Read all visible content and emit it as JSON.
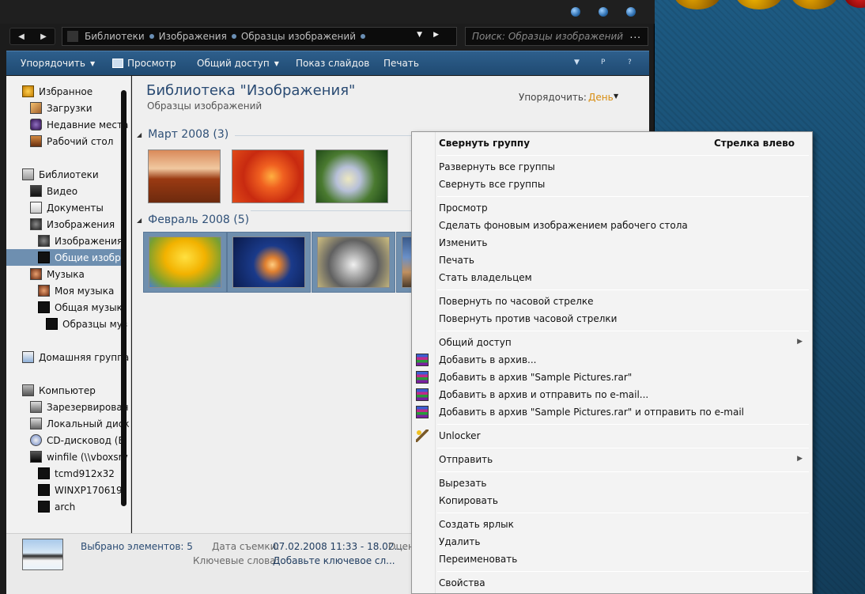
{
  "breadcrumb": [
    "Библиотеки",
    "Изображения",
    "Образцы изображений"
  ],
  "search": {
    "placeholder": "Поиск: Образцы изображений"
  },
  "toolbar": {
    "organize": "Упорядочить",
    "preview": "Просмотр",
    "share": "Общий доступ",
    "slideshow": "Показ слайдов",
    "print": "Печать"
  },
  "nav": [
    {
      "label": "Избранное",
      "icon": "star-icon"
    },
    {
      "label": "Загрузки",
      "icon": "downloads-icon"
    },
    {
      "label": "Недавние места",
      "icon": "recent-places-icon"
    },
    {
      "label": "Рабочий стол",
      "icon": "desktop-icon"
    },
    {
      "label": "Библиотеки",
      "icon": "libraries-icon"
    },
    {
      "label": "Видео",
      "icon": "video-icon"
    },
    {
      "label": "Документы",
      "icon": "documents-icon"
    },
    {
      "label": "Изображения",
      "icon": "pictures-icon"
    },
    {
      "label": "Изображения",
      "icon": "pictures-icon"
    },
    {
      "label": "Общие изобр",
      "icon": "folder-icon"
    },
    {
      "label": "Музыка",
      "icon": "music-icon"
    },
    {
      "label": "Моя музыка",
      "icon": "music-icon"
    },
    {
      "label": "Общая музык",
      "icon": "folder-icon"
    },
    {
      "label": "Образцы муз",
      "icon": "folder-icon"
    },
    {
      "label": "Домашняя группа",
      "icon": "homegroup-icon"
    },
    {
      "label": "Компьютер",
      "icon": "computer-icon"
    },
    {
      "label": "Зарезервирован",
      "icon": "drive-icon"
    },
    {
      "label": "Локальный диск",
      "icon": "drive-icon"
    },
    {
      "label": "CD-дисковод (E:",
      "icon": "cd-drive-icon"
    },
    {
      "label": "winfile (\\\\vboxsrv",
      "icon": "network-drive-icon"
    },
    {
      "label": "tcmd912x32",
      "icon": "folder-icon"
    },
    {
      "label": "WINXP170619",
      "icon": "folder-icon"
    },
    {
      "label": "arch",
      "icon": "folder-icon"
    }
  ],
  "library": {
    "title": "Библиотека \"Изображения\"",
    "subtitle": "Образцы изображений",
    "arrange_label": "Упорядочить:",
    "arrange_value": "День"
  },
  "groups": [
    {
      "label": "Март 2008 (3)"
    },
    {
      "label": "Февраль 2008 (5)"
    }
  ],
  "details": {
    "selected": "Выбрано элементов: 5",
    "date_label": "Дата съемки:",
    "date_value": "07.02.2008 11:33 - 18.02....",
    "rating_label": "Оцен",
    "keywords_label": "Ключевые слова:",
    "keywords_value": "Добавьте ключевое сл..."
  },
  "context_menu": [
    {
      "label": "Свернуть группу",
      "shortcut": "Стрелка влево"
    },
    {
      "label": "Развернуть все группы"
    },
    {
      "label": "Свернуть все группы"
    },
    {
      "label": "Просмотр"
    },
    {
      "label": "Сделать фоновым изображением рабочего стола"
    },
    {
      "label": "Изменить"
    },
    {
      "label": "Печать"
    },
    {
      "label": "Стать владельцем"
    },
    {
      "label": "Повернуть по часовой стрелке"
    },
    {
      "label": "Повернуть против часовой стрелки"
    },
    {
      "label": "Общий доступ"
    },
    {
      "label": "Добавить в архив..."
    },
    {
      "label": "Добавить в архив \"Sample Pictures.rar\""
    },
    {
      "label": "Добавить в архив и отправить по e-mail..."
    },
    {
      "label": "Добавить в архив \"Sample Pictures.rar\" и отправить по e-mail"
    },
    {
      "label": "Unlocker"
    },
    {
      "label": "Отправить"
    },
    {
      "label": "Вырезать"
    },
    {
      "label": "Копировать"
    },
    {
      "label": "Создать ярлык"
    },
    {
      "label": "Удалить"
    },
    {
      "label": "Переименовать"
    },
    {
      "label": "Свойства"
    }
  ]
}
